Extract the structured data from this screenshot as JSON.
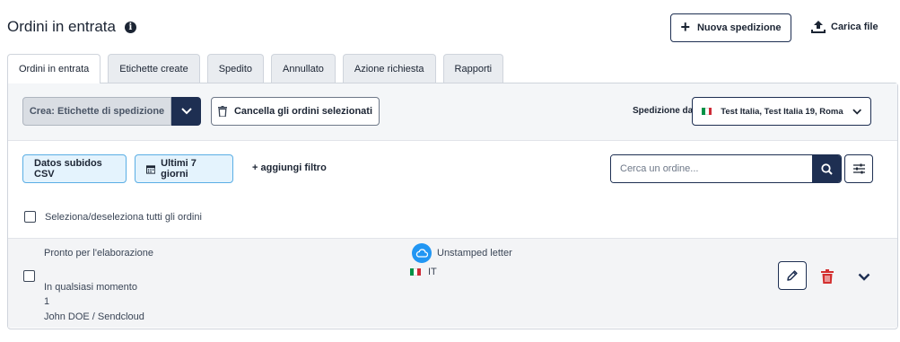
{
  "header": {
    "title": "Ordini in entrata",
    "info_icon": "i",
    "new_shipment_label": "Nuova spedizione",
    "upload_label": "Carica file"
  },
  "tabs": [
    {
      "label": "Ordini in entrata",
      "active": true
    },
    {
      "label": "Etichette create",
      "active": false
    },
    {
      "label": "Spedito",
      "active": false
    },
    {
      "label": "Annullato",
      "active": false
    },
    {
      "label": "Azione richiesta",
      "active": false
    },
    {
      "label": "Rapporti",
      "active": false
    }
  ],
  "toolbar": {
    "create_label": "Crea: Etichette di spedizione",
    "cancel_label": "Cancella gli ordini selezionati",
    "ship_from_label": "Spedizione da",
    "ship_from_value": "Test Italia, Test Italia 19, Roma"
  },
  "filters": {
    "csv_chip": "Datos subidos CSV",
    "date_chip": "Ultimi 7 giorni",
    "add_filter": "+ aggiungi filtro",
    "search_placeholder": "Cerca un ordine..."
  },
  "select_all_label": "Seleziona/deseleziona tutti gli ordini",
  "orders": [
    {
      "status": "Pronto per l'elaborazione",
      "time": "In qualsiasi momento",
      "quantity": "1",
      "customer": "John DOE / Sendcloud",
      "carrier": "Unstamped letter",
      "country": "IT"
    }
  ],
  "colors": {
    "primary": "#1e2f52",
    "chip_bg": "#e4f3fd",
    "chip_border": "#5aaee5",
    "delete": "#d32f2f",
    "carrier_icon": "#2196f3",
    "flag_green": "#009246",
    "flag_white": "#ffffff",
    "flag_red": "#ce2b37"
  },
  "icons": {
    "info": "info-icon",
    "plus": "plus-icon",
    "upload": "upload-icon",
    "chevron": "chevron-down-icon",
    "trash": "trash-icon",
    "calendar": "calendar-icon",
    "search": "search-icon",
    "settings": "sliders-icon",
    "carrier": "cloud-icon",
    "edit": "pencil-icon"
  }
}
